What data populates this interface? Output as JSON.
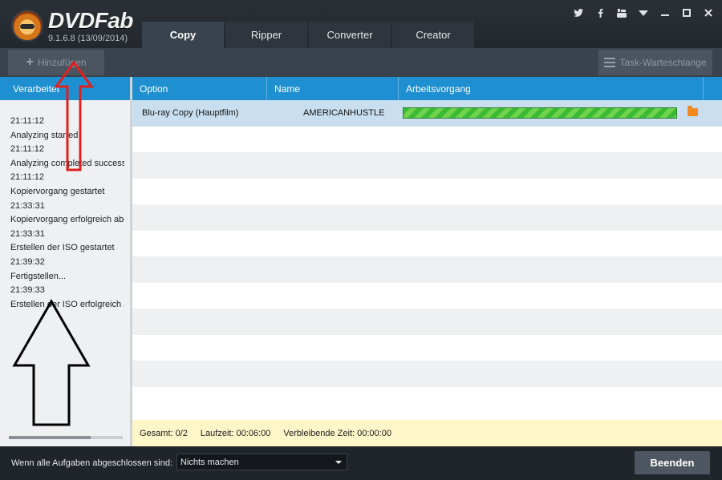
{
  "app": {
    "brand": "DVDFab",
    "version": "9.1.6.8 (13/09/2014)"
  },
  "tabs": [
    {
      "label": "Copy",
      "active": true
    },
    {
      "label": "Ripper",
      "active": false
    },
    {
      "label": "Converter",
      "active": false
    },
    {
      "label": "Creator",
      "active": false
    }
  ],
  "toolbar": {
    "add_label": "Hinzufügen",
    "queue_label": "Task-Warteschlange"
  },
  "left_panel": {
    "header": "Verarbeitet",
    "log": [
      "21:11:12",
      "Analyzing started",
      "21:11:12",
      "Analyzing completed successfully",
      "21:11:12",
      "Kopiervorgang gestartet",
      "21:33:31",
      "Kopiervorgang erfolgreich abgeschlossen",
      "21:33:31",
      "Erstellen der ISO gestartet",
      "21:39:32",
      "Fertigstellen...",
      "21:39:33",
      "Erstellen der ISO erfolgreich abgeschlossen"
    ]
  },
  "table": {
    "columns": {
      "option": "Option",
      "name": "Name",
      "progress": "Arbeitsvorgang"
    },
    "rows": [
      {
        "option": "Blu-ray Copy (Hauptfilm)",
        "name": "AMERICANHUSTLE",
        "progress": 1.0
      }
    ]
  },
  "status": {
    "total": "Gesamt: 0/2",
    "elapsed": "Laufzeit: 00:06:00",
    "remaining": "Verbleibende Zeit: 00:00:00"
  },
  "footer": {
    "label": "Wenn alle Aufgaben abgeschlossen sind:",
    "select_value": "Nichts machen",
    "end_button": "Beenden"
  },
  "icons": {
    "social": [
      "twitter-icon",
      "facebook-icon",
      "youtube-icon"
    ],
    "window": [
      "dropdown-menu-icon",
      "minimize-icon",
      "maximize-icon",
      "close-icon"
    ]
  },
  "colors": {
    "accent": "#1e8fd0",
    "progress": "#3cba36",
    "status_bg": "#fdf6c8",
    "annotation_red": "#e0201f"
  }
}
